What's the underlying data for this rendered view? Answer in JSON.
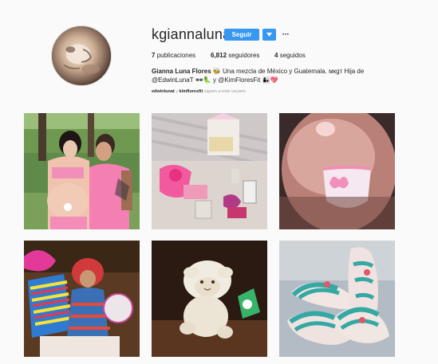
{
  "profile": {
    "username": "kgiannaluna",
    "follow_label": "Seguir",
    "more_label": "···",
    "avatar_alt": "profile-ultrasound"
  },
  "stats": {
    "posts_count": "7",
    "posts_label": "publicaciones",
    "followers_count": "6,812",
    "followers_label": "seguidores",
    "following_count": "4",
    "following_label": "seguidos"
  },
  "bio": {
    "full_name": "Gianna Luna Flores",
    "emoji_1": "🐝",
    "line_1": "Una mezcla de México y Guatemala. мкgт Hija de",
    "handle_1": "@EdwinLunaT",
    "emoji_2": "🕶🦜",
    "conjunction": "y",
    "handle_2": "@KimFloresFit",
    "emoji_3": "👩‍👧💖"
  },
  "followed_by": {
    "user_1": "edwinlunat",
    "and": "y",
    "user_2": "kimfloresfit",
    "suffix": "siguen a este usuario"
  },
  "colors": {
    "accent": "#3897f0",
    "text": "#262626",
    "muted": "#999999",
    "background": "#fafafa"
  },
  "posts": [
    {
      "name": "couple-maternity-photo"
    },
    {
      "name": "baby-gifts-table"
    },
    {
      "name": "baby-belly-bib"
    },
    {
      "name": "guatemalan-doll-gift"
    },
    {
      "name": "plush-lamb-toy"
    },
    {
      "name": "baby-slip-on-shoes"
    }
  ]
}
